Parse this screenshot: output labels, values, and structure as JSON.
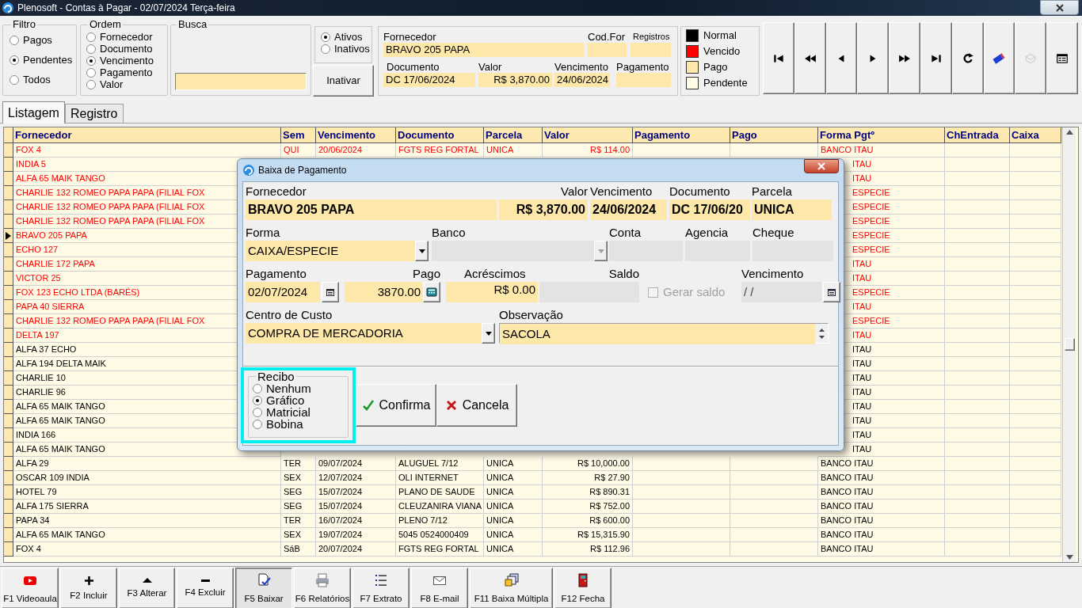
{
  "window": {
    "title": "Plenosoft - Contas à Pagar - 02/07/2024 Terça-feira"
  },
  "filter": {
    "title": "Filtro",
    "options": [
      {
        "label": "Pagos",
        "selected": false
      },
      {
        "label": "Pendentes",
        "selected": true
      },
      {
        "label": "Todos",
        "selected": false
      }
    ]
  },
  "order": {
    "title": "Ordem",
    "options": [
      {
        "label": "Fornecedor",
        "selected": false
      },
      {
        "label": "Documento",
        "selected": false
      },
      {
        "label": "Vencimento",
        "selected": true
      },
      {
        "label": "Pagamento",
        "selected": false
      },
      {
        "label": "Valor",
        "selected": false
      }
    ]
  },
  "search": {
    "title": "Busca"
  },
  "active_filter": {
    "options": [
      {
        "label": "Ativos",
        "selected": true
      },
      {
        "label": "Inativos",
        "selected": false
      }
    ]
  },
  "inactivate_button": "Inativar",
  "record": {
    "fields": [
      {
        "label": "Fornecedor",
        "value": "BRAVO 205 PAPA"
      },
      {
        "label": "Cod.For"
      },
      {
        "label": "Registros"
      },
      {
        "label": "Documento",
        "value": "DC 17/06/2024"
      },
      {
        "label": "Valor",
        "value": "R$ 3,870.00"
      },
      {
        "label": "Vencimento",
        "value": "24/06/2024"
      },
      {
        "label": "Pagamento"
      }
    ]
  },
  "legend": [
    {
      "label": "Normal",
      "color": "#000000"
    },
    {
      "label": "Vencido",
      "color": "#ff0000"
    },
    {
      "label": "Pago",
      "color": "#fde7a9"
    },
    {
      "label": "Pendente",
      "color": "#fffbe7"
    }
  ],
  "nav_buttons": [
    {
      "kind": "first",
      "disabled": false
    },
    {
      "kind": "prev_page",
      "disabled": false
    },
    {
      "kind": "prev",
      "disabled": false
    },
    {
      "kind": "next",
      "disabled": false
    },
    {
      "kind": "next_page",
      "disabled": false
    },
    {
      "kind": "last",
      "disabled": false
    },
    {
      "kind": "refresh",
      "disabled": false
    },
    {
      "kind": "eraser",
      "disabled": false
    },
    {
      "kind": "goto",
      "disabled": true
    },
    {
      "kind": "form",
      "disabled": false
    }
  ],
  "tabs": [
    {
      "label": "Listagem",
      "selected": true
    },
    {
      "label": "Registro",
      "selected": false
    }
  ],
  "table": {
    "columns": [
      "Fornecedor",
      "Sem",
      "Vencimento",
      "Documento",
      "Parcela",
      "Valor",
      "Pagamento",
      "Pago",
      "Forma Pgtº",
      "ChEntrada",
      "Caixa"
    ],
    "rows": [
      {
        "kind": "full",
        "overdue": true,
        "selected": false,
        "fornecedor": "FOX 4",
        "sem": "QUI",
        "vencimento": "20/06/2024",
        "documento": "FGTS REG FORTAL",
        "parcela": "UNICA",
        "valor": "R$ 114.00",
        "forma": "BANCO ITAU"
      },
      {
        "kind": "covered",
        "overdue": true,
        "selected": false,
        "fornecedor": "INDIA 5",
        "forma": "ITAU"
      },
      {
        "kind": "covered",
        "overdue": true,
        "selected": false,
        "fornecedor": "ALFA 65 MAIK TANGO",
        "forma": "ITAU"
      },
      {
        "kind": "covered",
        "overdue": true,
        "selected": false,
        "fornecedor": "CHARLIE 132 ROMEO PAPA PAPA (FILIAL FOX",
        "forma": "ESPECIE"
      },
      {
        "kind": "covered",
        "overdue": true,
        "selected": false,
        "fornecedor": "CHARLIE 132 ROMEO PAPA PAPA (FILIAL FOX",
        "forma": "ESPECIE"
      },
      {
        "kind": "covered",
        "overdue": true,
        "selected": false,
        "fornecedor": "CHARLIE 132 ROMEO PAPA PAPA (FILIAL FOX",
        "forma": "ESPECIE"
      },
      {
        "kind": "covered",
        "overdue": true,
        "selected": true,
        "fornecedor": "BRAVO 205 PAPA",
        "forma": "ESPECIE"
      },
      {
        "kind": "covered",
        "overdue": true,
        "selected": false,
        "fornecedor": "ECHO 127",
        "forma": "ESPECIE"
      },
      {
        "kind": "covered",
        "overdue": true,
        "selected": false,
        "fornecedor": "CHARLIE 172 PAPA",
        "forma": "ITAU"
      },
      {
        "kind": "covered",
        "overdue": true,
        "selected": false,
        "fornecedor": "VICTOR 25",
        "forma": "ITAU"
      },
      {
        "kind": "covered",
        "overdue": true,
        "selected": false,
        "fornecedor": "FOX 123 ECHO LTDA (BARÉS)",
        "forma": "ESPECIE"
      },
      {
        "kind": "covered",
        "overdue": true,
        "selected": false,
        "fornecedor": "PAPA 40 SIERRA",
        "forma": "ITAU"
      },
      {
        "kind": "covered",
        "overdue": true,
        "selected": false,
        "fornecedor": "CHARLIE 132 ROMEO PAPA PAPA (FILIAL FOX",
        "forma": "ESPECIE"
      },
      {
        "kind": "covered",
        "overdue": true,
        "selected": false,
        "fornecedor": "DELTA 197",
        "forma": "ITAU"
      },
      {
        "kind": "covered",
        "overdue": false,
        "selected": false,
        "fornecedor": "ALFA 37 ECHO",
        "forma": "ITAU"
      },
      {
        "kind": "covered",
        "overdue": false,
        "selected": false,
        "fornecedor": "ALFA 194 DELTA MAIK",
        "forma": "ITAU"
      },
      {
        "kind": "covered",
        "overdue": false,
        "selected": false,
        "fornecedor": "CHARLIE 10",
        "forma": "ITAU"
      },
      {
        "kind": "covered",
        "overdue": false,
        "selected": false,
        "fornecedor": "CHARLIE 96",
        "forma": "ITAU"
      },
      {
        "kind": "covered",
        "overdue": false,
        "selected": false,
        "fornecedor": "ALFA 65 MAIK TANGO",
        "forma": "ITAU"
      },
      {
        "kind": "covered",
        "overdue": false,
        "selected": false,
        "fornecedor": "ALFA 65 MAIK TANGO",
        "forma": "ITAU"
      },
      {
        "kind": "covered",
        "overdue": false,
        "selected": false,
        "fornecedor": "INDIA 166",
        "forma": "ITAU"
      },
      {
        "kind": "covered",
        "overdue": false,
        "selected": false,
        "fornecedor": "ALFA 65 MAIK TANGO",
        "forma": "ITAU"
      },
      {
        "kind": "full",
        "overdue": false,
        "selected": false,
        "fornecedor": "ALFA 29",
        "sem": "TER",
        "vencimento": "09/07/2024",
        "documento": "ALUGUEL 7/12",
        "parcela": "UNICA",
        "valor": "R$ 10,000.00",
        "forma": "BANCO ITAU"
      },
      {
        "kind": "full",
        "overdue": false,
        "selected": false,
        "fornecedor": "OSCAR 109 INDIA",
        "sem": "SEX",
        "vencimento": "12/07/2024",
        "documento": "OLI INTERNET",
        "parcela": "UNICA",
        "valor": "R$ 27.90",
        "forma": "BANCO ITAU"
      },
      {
        "kind": "full",
        "overdue": false,
        "selected": false,
        "fornecedor": "HOTEL 79",
        "sem": "SEG",
        "vencimento": "15/07/2024",
        "documento": "PLANO DE SAUDE",
        "parcela": "UNICA",
        "valor": "R$ 890.31",
        "forma": "BANCO ITAU"
      },
      {
        "kind": "full",
        "overdue": false,
        "selected": false,
        "fornecedor": "ALFA 175 SIERRA",
        "sem": "SEG",
        "vencimento": "15/07/2024",
        "documento": "CLEUZANIRA VIANA",
        "parcela": "UNICA",
        "valor": "R$ 752.00",
        "forma": "BANCO ITAU"
      },
      {
        "kind": "full",
        "overdue": false,
        "selected": false,
        "fornecedor": "PAPA 34",
        "sem": "TER",
        "vencimento": "16/07/2024",
        "documento": "PLENO 7/12",
        "parcela": "UNICA",
        "valor": "R$ 600.00",
        "forma": "BANCO ITAU"
      },
      {
        "kind": "full",
        "overdue": false,
        "selected": false,
        "fornecedor": "ALFA 65 MAIK TANGO",
        "sem": "SEX",
        "vencimento": "19/07/2024",
        "documento": "5045 0524000409",
        "parcela": "UNICA",
        "valor": "R$ 15,315.90",
        "forma": "BANCO ITAU"
      },
      {
        "kind": "full",
        "overdue": false,
        "selected": false,
        "fornecedor": "FOX 4",
        "sem": "SáB",
        "vencimento": "20/07/2024",
        "documento": "FGTS REG FORTAL",
        "parcela": "UNICA",
        "valor": "R$ 112.96",
        "forma": "BANCO ITAU"
      }
    ]
  },
  "dialog": {
    "title": "Baixa de Pagamento",
    "fields": [
      {
        "kind": "text",
        "label": "Fornecedor",
        "value": "BRAVO 205 PAPA"
      },
      {
        "kind": "text",
        "label": "Valor",
        "value": "R$ 3,870.00"
      },
      {
        "kind": "text",
        "label": "Vencimento",
        "value": "24/06/2024"
      },
      {
        "kind": "text",
        "label": "Documento",
        "value": "DC 17/06/20"
      },
      {
        "kind": "text",
        "label": "Parcela",
        "value": "UNICA"
      },
      {
        "kind": "combo",
        "label": "Forma",
        "value": "CAIXA/ESPECIE",
        "disabled": false
      },
      {
        "kind": "combo",
        "label": "Banco",
        "disabled": true
      },
      {
        "kind": "text",
        "label": "Conta",
        "disabled": true
      },
      {
        "kind": "text",
        "label": "Agencia",
        "disabled": true
      },
      {
        "kind": "text",
        "label": "Cheque",
        "disabled": true
      },
      {
        "kind": "date",
        "label": "Pagamento",
        "value": "02/07/2024",
        "disabled": false
      },
      {
        "kind": "calc",
        "label": "Pago",
        "value": "3870.00"
      },
      {
        "kind": "text",
        "label": "Acréscimos",
        "value": "R$ 0.00",
        "disabled": false
      },
      {
        "kind": "text",
        "label": "Saldo",
        "disabled": true
      },
      {
        "kind": "check",
        "label": "Gerar saldo",
        "checked": false,
        "disabled": true
      },
      {
        "kind": "date",
        "label": "Vencimento",
        "value": "/ /",
        "disabled": true
      },
      {
        "kind": "combo",
        "label": "Centro de Custo",
        "value": "COMPRA DE MERCADORIA",
        "disabled": false
      },
      {
        "kind": "memo",
        "label": "Observação",
        "value": "SACOLA"
      }
    ],
    "receipt": {
      "title": "Recibo",
      "options": [
        {
          "label": "Nenhum",
          "selected": false
        },
        {
          "label": "Gráfico",
          "selected": true
        },
        {
          "label": "Matricial",
          "selected": false
        },
        {
          "label": "Bobina",
          "selected": false
        }
      ]
    },
    "buttons": [
      {
        "label": "Confirma",
        "kind": "confirm"
      },
      {
        "label": "Cancela",
        "kind": "cancel"
      }
    ]
  },
  "toolbar": [
    {
      "label": "F1 Videoaula",
      "kind": "video",
      "selected": false
    },
    {
      "label": "F2 Incluir",
      "kind": "plus",
      "selected": false
    },
    {
      "label": "F3 Alterar",
      "kind": "up",
      "selected": false
    },
    {
      "label": "F4 Excluir",
      "kind": "minus",
      "selected": false
    },
    {
      "label": "F5 Baixar",
      "kind": "baixar",
      "selected": true
    },
    {
      "label": "F6 Relatórios",
      "kind": "printer",
      "selected": false
    },
    {
      "label": "F7 Extrato",
      "kind": "list",
      "selected": false
    },
    {
      "label": "F8 E-mail",
      "kind": "mail",
      "selected": false
    },
    {
      "label": "F11 Baixa Múltipla",
      "kind": "multiple",
      "selected": false
    },
    {
      "label": "F12 Fecha",
      "kind": "exit",
      "selected": false
    }
  ]
}
